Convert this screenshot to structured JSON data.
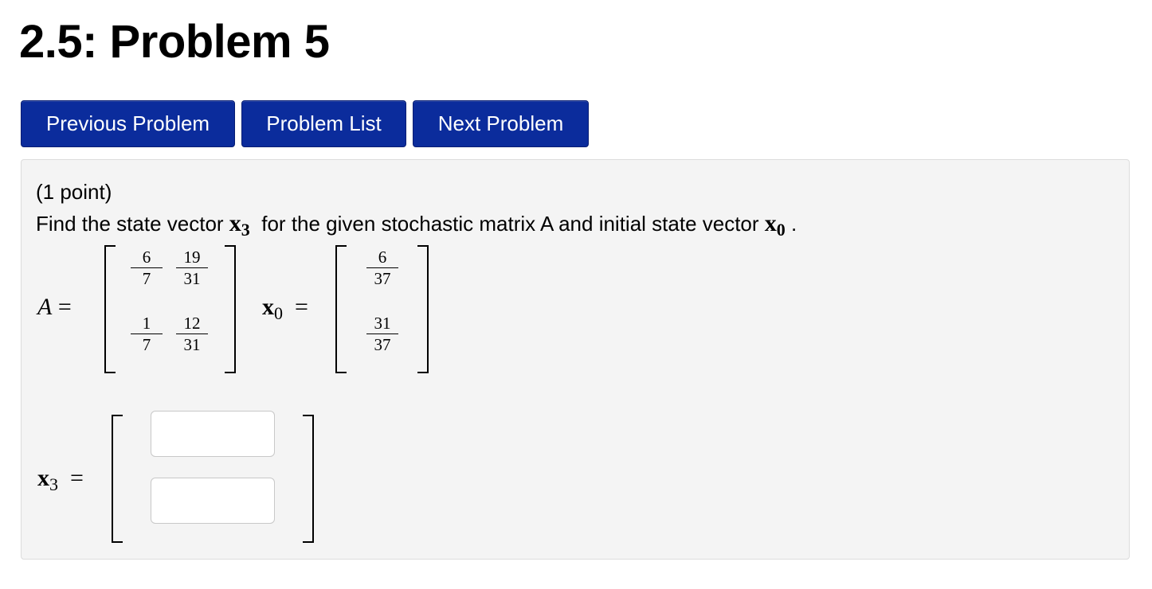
{
  "page": {
    "title": "2.5: Problem 5"
  },
  "nav": {
    "previous_label": "Previous Problem",
    "list_label": "Problem List",
    "next_label": "Next Problem"
  },
  "problem": {
    "points": "(1 point)",
    "statement_before": "Find the state vector",
    "statement_middle": "for the given stochastic matrix A and initial state vector",
    "statement_end": ".",
    "x_symbol": "x",
    "x3_sub": "3",
    "x0_sub": "0",
    "matrix_A": {
      "label": "A",
      "equals": "=",
      "entries": [
        [
          {
            "num": "6",
            "den": "7"
          },
          {
            "num": "19",
            "den": "31"
          }
        ],
        [
          {
            "num": "1",
            "den": "7"
          },
          {
            "num": "12",
            "den": "31"
          }
        ]
      ]
    },
    "vector_x0": {
      "equals": "=",
      "entries": [
        {
          "num": "6",
          "den": "37"
        },
        {
          "num": "31",
          "den": "37"
        }
      ]
    },
    "answer": {
      "equals": "=",
      "inputs": [
        {
          "value": "",
          "placeholder": ""
        },
        {
          "value": "",
          "placeholder": ""
        }
      ]
    }
  }
}
